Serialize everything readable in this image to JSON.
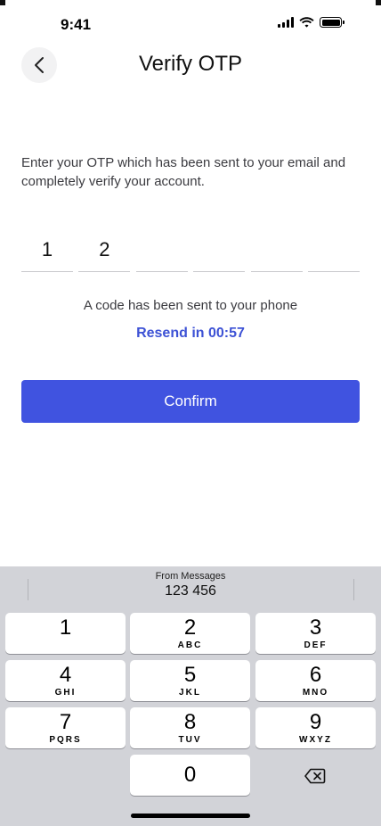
{
  "status_bar": {
    "time": "9:41"
  },
  "header": {
    "title": "Verify OTP"
  },
  "instructions": "Enter your OTP which has been sent to your email and completely verify your account.",
  "otp": {
    "digits": [
      "1",
      "2",
      "",
      "",
      "",
      ""
    ]
  },
  "sent_message": "A code has been sent to your phone",
  "resend": "Resend in 00:57",
  "confirm_label": "Confirm",
  "colors": {
    "accent": "#4053e0",
    "link": "#3d52d5",
    "keyboard_bg": "#d2d3d8"
  },
  "keyboard": {
    "suggestion": {
      "label": "From Messages",
      "code": "123 456"
    },
    "keys": [
      {
        "num": "1",
        "letters": ""
      },
      {
        "num": "2",
        "letters": "ABC"
      },
      {
        "num": "3",
        "letters": "DEF"
      },
      {
        "num": "4",
        "letters": "GHI"
      },
      {
        "num": "5",
        "letters": "JKL"
      },
      {
        "num": "6",
        "letters": "MNO"
      },
      {
        "num": "7",
        "letters": "PQRS"
      },
      {
        "num": "8",
        "letters": "TUV"
      },
      {
        "num": "9",
        "letters": "WXYZ"
      },
      {
        "num": "0",
        "letters": ""
      }
    ],
    "delete_icon": "delete-icon"
  }
}
